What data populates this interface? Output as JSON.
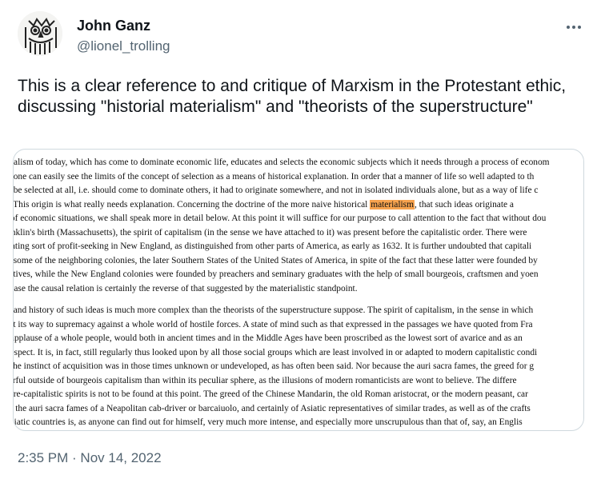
{
  "tweet": {
    "author": {
      "display_name": "John Ganz",
      "handle": "@lionel_trolling",
      "avatar_icon": "owl-drawing-avatar"
    },
    "text": "This is a clear reference to and critique of Marxism in the Protestant ethic, discussing \"historial materialism\" and \"theorists of the superstructure\"",
    "timestamp": "2:35 PM · Nov 14, 2022",
    "more_icon": "more-horizontal-icon"
  },
  "image": {
    "paragraph1": [
      "pitalism of today, which has come to dominate economic life, educates and selects the economic subjects which it needs through a process of econom",
      "re one can easily see the limits of the concept of selection as a means of historical explanation. In order that a manner of life so well adapted to th",
      "ld be selected at all, i.e. should come to dominate others, it had to originate somewhere, and not in isolated individuals alone, but as a way of life c",
      "n. This origin is what really needs explanation. Concerning the doctrine of the more naive historical ",
      "e of economic situations, we shall speak more in detail below. At this point it will suffice for our purpose to call attention to the fact that without dou",
      "ranklin's birth (Massachusetts), the spirit of capitalism (in the sense we have attached to it) was present before the capitalistic order. There were",
      "ulating sort of profit-seeking in New England, as distinguished from other parts of America, as early as 1632. It is further undoubted that capitali",
      " in some of the neighboring colonies, the later Southern States of the United States of America, in spite of the fact that these latter were founded by",
      "notives, while the New England colonies were founded by preachers and seminary graduates with the help of small bourgeois, craftsmen and yoen",
      "s case the causal relation is certainly the reverse of that suggested by the materialistic standpoint."
    ],
    "highlight_word": "materialism",
    "line4_after": ", that such ideas originate a",
    "paragraph2": [
      "in and history of such ideas is much more complex than the theorists of the superstructure suppose. The spirit of capitalism, in the sense in which",
      "ght its way to supremacy against a whole world of hostile forces. A state of mind such as that expressed in the passages we have quoted from Fra",
      "e applause of a whole people, would both in ancient times and in the Middle Ages have been proscribed as the lowest sort of avarice and as an",
      "-respect. It is, in fact, still regularly thus looked upon by all those social groups which are least involved in or adapted to modern capitalistic condi",
      "e the instinct of acquisition was in those times unknown or undeveloped, as has often been said. Nor because the auri sacra fames, the greed for g",
      "verful outside of bourgeois capitalism than within its peculiar sphere, as the illusions of modern romanticists are wont to believe. The differe",
      "l pre-capitalistic spirits is not to be found at this point. The greed of the Chinese Mandarin, the old Roman aristocrat, or the modern peasant, car",
      "nd the auri sacra fames of a Neapolitan cab-driver or barcaiuolo, and certainly of Asiatic representatives of similar trades, as well as of the crafts",
      "Asiatic countries is, as anyone can find out for himself, very much more intense, and especially more unscrupulous than that of, say, an Englis"
    ]
  },
  "colors": {
    "text": "#0f1419",
    "secondary": "#536471",
    "border": "#cfd9de",
    "highlight": "#f7a34e"
  }
}
